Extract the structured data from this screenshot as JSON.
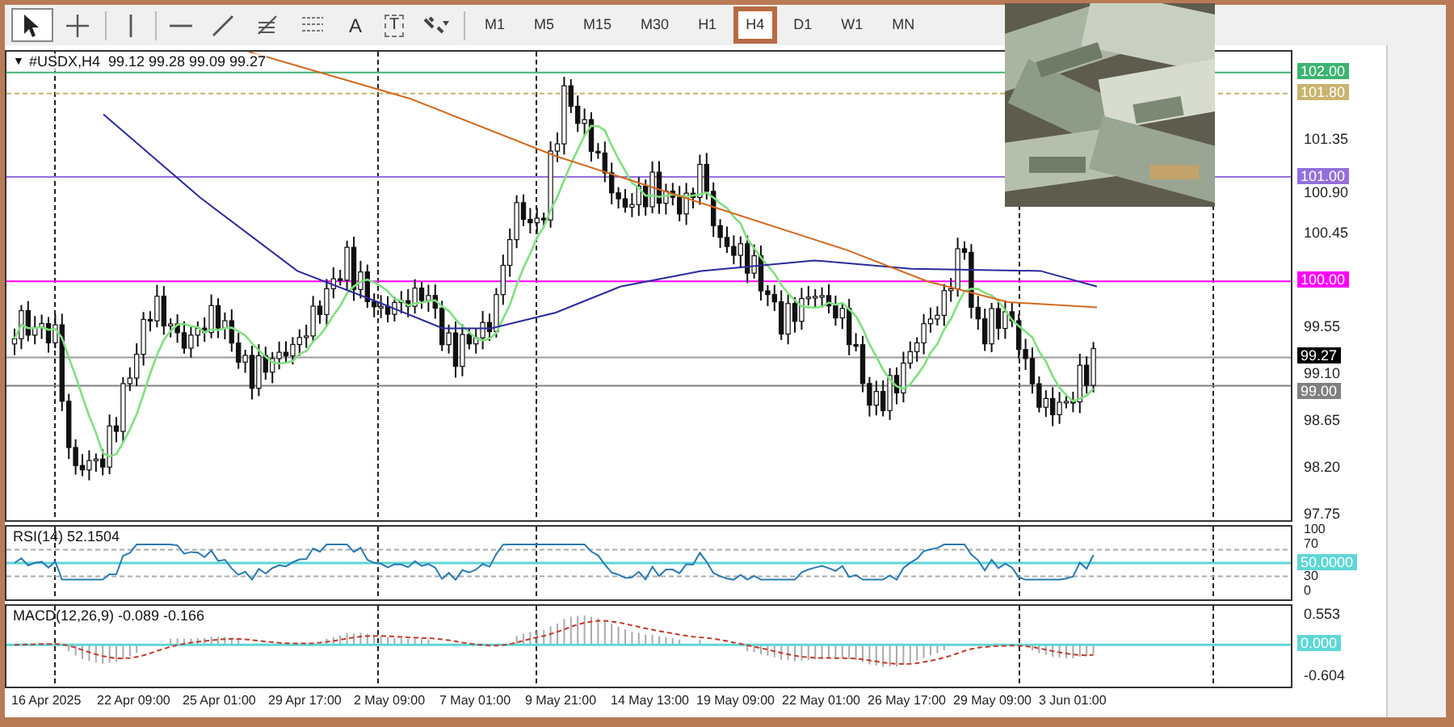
{
  "toolbar": {
    "tools": [
      {
        "kind": "cursor",
        "selected": true
      },
      {
        "kind": "crosshair",
        "selected": false
      },
      {
        "kind": "vline",
        "selected": false
      },
      {
        "kind": "hline",
        "selected": false
      },
      {
        "kind": "trendline",
        "selected": false
      },
      {
        "kind": "fibo",
        "selected": false
      },
      {
        "kind": "channel",
        "selected": false
      },
      {
        "kind": "text",
        "label": "A",
        "selected": false
      },
      {
        "kind": "label",
        "label": "T",
        "selected": false
      },
      {
        "kind": "shapes",
        "selected": false
      }
    ],
    "timeframes": [
      {
        "label": "M1",
        "selected": false
      },
      {
        "label": "M5",
        "selected": false
      },
      {
        "label": "M15",
        "selected": false
      },
      {
        "label": "M30",
        "selected": false
      },
      {
        "label": "H1",
        "selected": false
      },
      {
        "label": "H4",
        "selected": true
      },
      {
        "label": "D1",
        "selected": false
      },
      {
        "label": "W1",
        "selected": false
      },
      {
        "label": "MN",
        "selected": false
      }
    ]
  },
  "chart": {
    "header": {
      "arrow": "▼",
      "text": "#USDX,H4  99.12 99.28 99.09 99.27"
    },
    "price_ticks": [
      "101.35",
      "100.90",
      "100.45",
      "99.55",
      "99.10",
      "98.65",
      "98.20",
      "97.75"
    ],
    "levels": [
      {
        "label": "102.00",
        "color": "#3cb371"
      },
      {
        "label": "101.80",
        "color": "#c8b46e"
      },
      {
        "label": "101.00",
        "color": "#9370db"
      },
      {
        "label": "100.00",
        "color": "#ff00ff"
      },
      {
        "label": "99.27",
        "color": "#000000"
      },
      {
        "label": "99.00",
        "color": "#808080"
      }
    ]
  },
  "rsi": {
    "header": "RSI(14) 52.1504",
    "ticks": [
      "100",
      "70",
      "30",
      "0"
    ],
    "baseline": {
      "label": "50.0000",
      "color": "#5fd6d6"
    }
  },
  "macd": {
    "header": "MACD(12,26,9) -0.089 -0.166",
    "ticks": [
      "0.553",
      "-0.604"
    ],
    "baseline": {
      "label": "0.000",
      "color": "#5fd6d6"
    }
  },
  "time_axis": [
    "16 Apr 2025",
    "22 Apr 09:00",
    "25 Apr 01:00",
    "29 Apr 17:00",
    "2 May 09:00",
    "7 May 01:00",
    "9 May 21:00",
    "14 May 13:00",
    "19 May 09:00",
    "22 May 01:00",
    "26 May 17:00",
    "29 May 09:00",
    "3 Jun 01:00"
  ]
}
